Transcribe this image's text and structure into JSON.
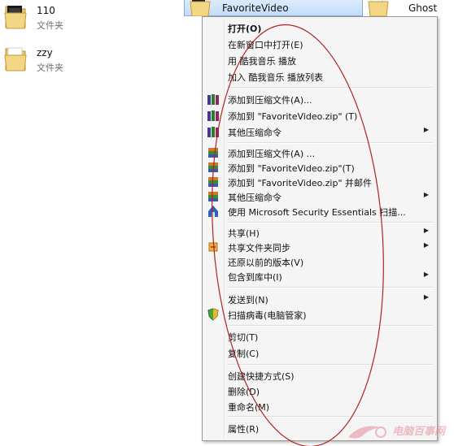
{
  "folders": [
    {
      "name": "110",
      "type": "文件夹",
      "icon": "folder-icon"
    },
    {
      "name": "zzy",
      "type": "文件夹",
      "icon": "folder-icon"
    }
  ],
  "selected_folder": {
    "name": "FavoriteVideo",
    "icon": "folder-icon"
  },
  "right_folder": {
    "name": "Ghost",
    "icon": "folder-icon"
  },
  "context_menu": {
    "items": [
      {
        "label": "打开(O)",
        "bold": true
      },
      {
        "label": "在新窗口中打开(E)"
      },
      {
        "label": "用 酷我音乐 播放"
      },
      {
        "label": "加入 酷我音乐 播放列表"
      },
      {
        "label": "添加到压缩文件(A)...",
        "icon": "winrar-books-icon"
      },
      {
        "label": "添加到 \"FavoriteVideo.zip\" (T)",
        "icon": "winrar-books-icon"
      },
      {
        "label": "其他压缩命令",
        "icon": "winrar-books-icon",
        "submenu": true
      },
      {
        "label": "添加到压缩文件(A) ...",
        "icon": "archive-stack-icon"
      },
      {
        "label": "添加到 \"FavoriteVideo.zip\"(T)",
        "icon": "archive-stack-icon"
      },
      {
        "label": "添加到 \"FavoriteVideo.zip\" 并邮件",
        "icon": "archive-stack-icon"
      },
      {
        "label": "其他压缩命令",
        "icon": "archive-stack-icon",
        "submenu": true
      },
      {
        "label": "使用 Microsoft Security Essentials 扫描...",
        "icon": "security-essentials-icon"
      },
      {
        "label": "共享(H)",
        "submenu": true
      },
      {
        "label": "共享文件夹同步",
        "icon": "sync-icon",
        "submenu": true
      },
      {
        "label": "还原以前的版本(V)"
      },
      {
        "label": "包含到库中(I)",
        "submenu": true
      },
      {
        "label": "发送到(N)",
        "submenu": true
      },
      {
        "label": "扫描病毒(电脑管家)",
        "icon": "shield-icon"
      },
      {
        "label": "剪切(T)"
      },
      {
        "label": "复制(C)"
      },
      {
        "label": "创建快捷方式(S)"
      },
      {
        "label": "删除(D)"
      },
      {
        "label": "重命名(M)"
      },
      {
        "label": "属性(R)"
      }
    ]
  },
  "watermark": {
    "text": "电脑百事网"
  },
  "colors": {
    "annotation_ellipse": "#b22222",
    "selection": "#cce1fb"
  }
}
